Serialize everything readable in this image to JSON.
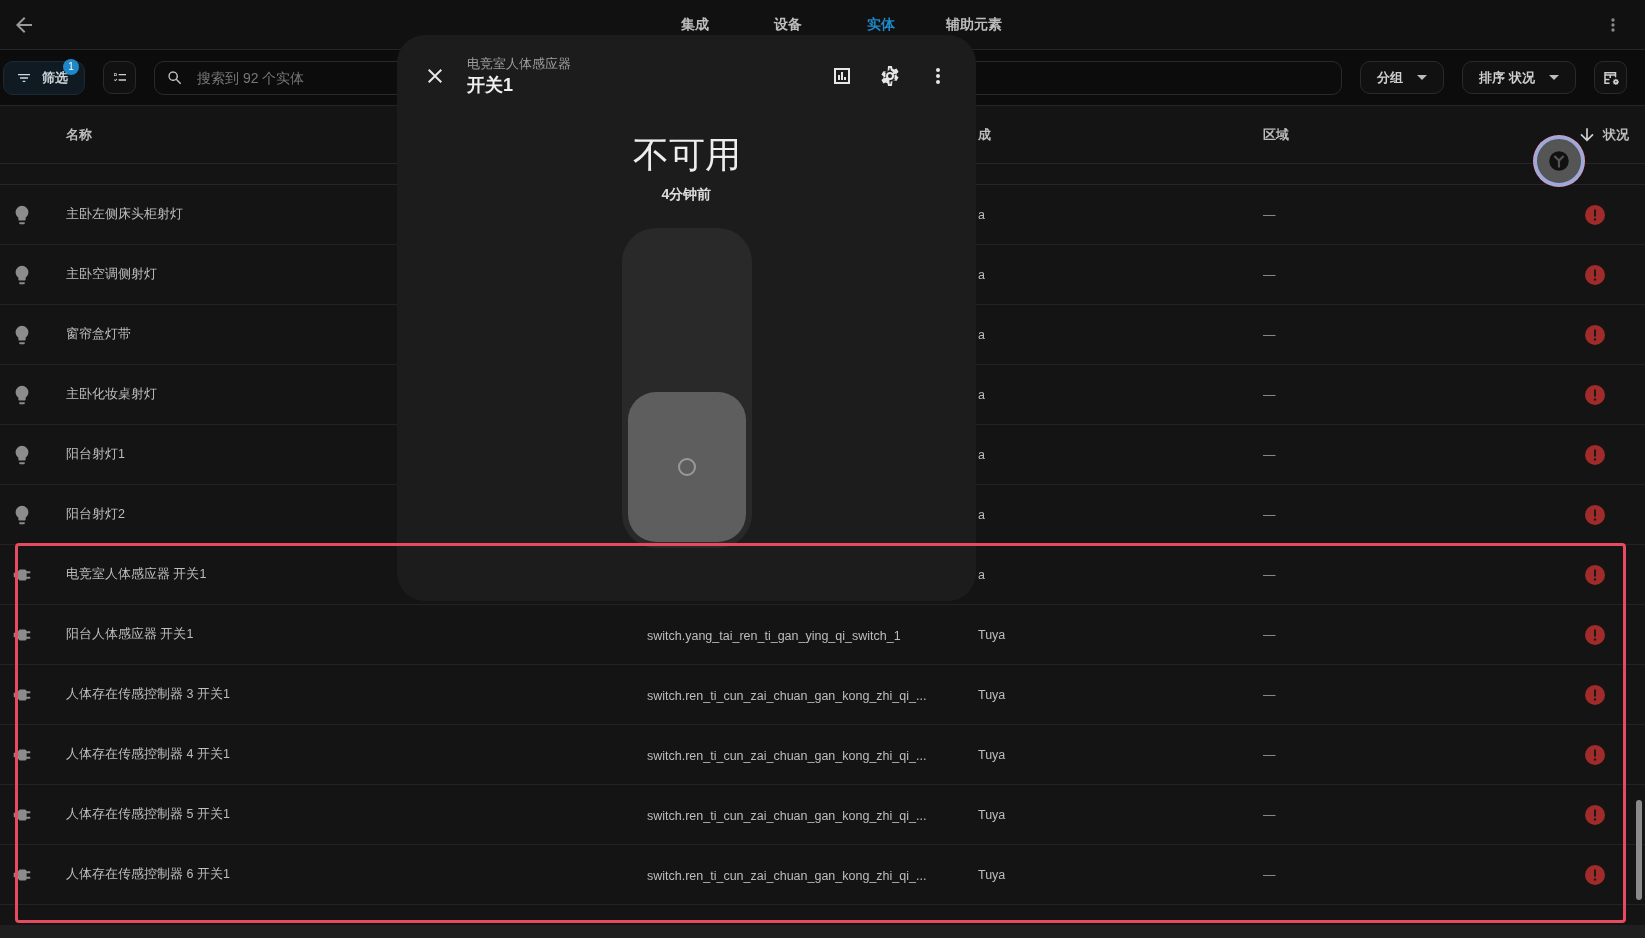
{
  "top_bar": {
    "tabs": [
      {
        "label": "集成",
        "selected": false
      },
      {
        "label": "设备",
        "selected": false
      },
      {
        "label": "实体",
        "selected": true
      },
      {
        "label": "辅助元素",
        "selected": false
      }
    ]
  },
  "toolbar": {
    "filter": {
      "label": "筛选",
      "badge": "1"
    },
    "search": {
      "placeholder": "搜索到 92 个实体"
    },
    "group": {
      "label": "分组"
    },
    "sort": {
      "label": "排序 状况"
    }
  },
  "table": {
    "header": {
      "name": "名称",
      "integration": "成",
      "area": "区域",
      "status": "状况"
    },
    "rows": [
      {
        "kind": "light",
        "name": "主卧左侧床头柜射灯",
        "integration": "a",
        "area": "—",
        "unavailable": true
      },
      {
        "kind": "light",
        "name": "主卧空调侧射灯",
        "integration": "a",
        "area": "—",
        "unavailable": true
      },
      {
        "kind": "light",
        "name": "窗帘盒灯带",
        "integration": "a",
        "area": "—",
        "unavailable": true
      },
      {
        "kind": "light",
        "name": "主卧化妆桌射灯",
        "integration": "a",
        "area": "—",
        "unavailable": true
      },
      {
        "kind": "light",
        "name": "阳台射灯1",
        "integration": "a",
        "area": "—",
        "unavailable": true
      },
      {
        "kind": "light",
        "name": "阳台射灯2",
        "integration": "a",
        "area": "—",
        "unavailable": true
      },
      {
        "kind": "switch",
        "name": "电竞室人体感应器 开关1",
        "integration": "a",
        "area": "—",
        "unavailable": true
      },
      {
        "kind": "switch",
        "name": "阳台人体感应器 开关1",
        "entity_id": "switch.yang_tai_ren_ti_gan_ying_qi_switch_1",
        "integration": "Tuya",
        "area": "—",
        "unavailable": true
      },
      {
        "kind": "switch",
        "name": "人体存在传感控制器 3 开关1",
        "entity_id": "switch.ren_ti_cun_zai_chuan_gan_kong_zhi_qi_...",
        "integration": "Tuya",
        "area": "—",
        "unavailable": true
      },
      {
        "kind": "switch",
        "name": "人体存在传感控制器 4 开关1",
        "entity_id": "switch.ren_ti_cun_zai_chuan_gan_kong_zhi_qi_...",
        "integration": "Tuya",
        "area": "—",
        "unavailable": true
      },
      {
        "kind": "switch",
        "name": "人体存在传感控制器 5 开关1",
        "entity_id": "switch.ren_ti_cun_zai_chuan_gan_kong_zhi_qi_...",
        "integration": "Tuya",
        "area": "—",
        "unavailable": true
      },
      {
        "kind": "switch",
        "name": "人体存在传感控制器 6 开关1",
        "entity_id": "switch.ren_ti_cun_zai_chuan_gan_kong_zhi_qi_...",
        "integration": "Tuya",
        "area": "—",
        "unavailable": true
      }
    ]
  },
  "dialog": {
    "subtitle": "电竞室人体感应器",
    "title": "开关1",
    "state": "不可用",
    "last_changed": "4分钟前",
    "toggle": {
      "on": false
    }
  }
}
